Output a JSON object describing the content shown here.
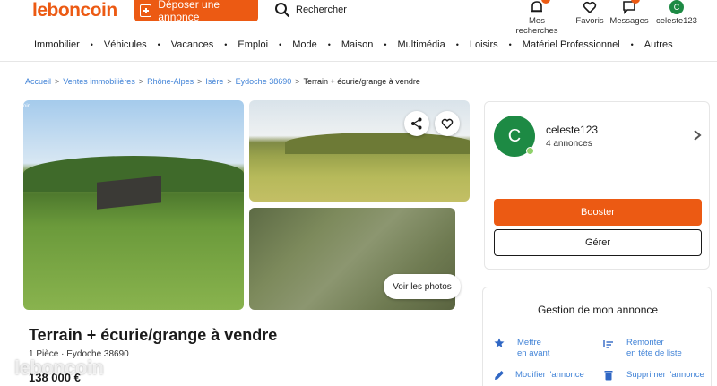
{
  "header": {
    "logo": "leboncoin",
    "deposer_label": "Déposer une annonce",
    "search_label": "Rechercher",
    "items": [
      {
        "label": "Mes recherches",
        "icon": "bell-icon"
      },
      {
        "label": "Favoris",
        "icon": "heart-icon"
      },
      {
        "label": "Messages",
        "icon": "chat-icon"
      },
      {
        "label": "celeste123",
        "icon": "avatar-icon",
        "avatar_letter": "C"
      }
    ]
  },
  "nav": [
    "Immobilier",
    "Véhicules",
    "Vacances",
    "Emploi",
    "Mode",
    "Maison",
    "Multimédia",
    "Loisirs",
    "Matériel Professionnel",
    "Autres"
  ],
  "breadcrumb": [
    "Accueil",
    "Ventes immobilières",
    "Rhône-Alpes",
    "Isère",
    "Eydoche 38690",
    "Terrain + écurie/grange à vendre"
  ],
  "gallery": {
    "voir_photos": "Voir les photos",
    "corner_text": "oin"
  },
  "listing": {
    "title": "Terrain + écurie/grange à vendre",
    "subtitle": "1 Pièce · Eydoche 38690",
    "price": "138 000 €",
    "watermark": "leboncoin"
  },
  "seller": {
    "avatar_letter": "C",
    "name": "celeste123",
    "count": "4 annonces",
    "booster_label": "Booster",
    "gerer_label": "Gérer"
  },
  "gestion": {
    "title": "Gestion de mon annonce",
    "actions": [
      {
        "line1": "Mettre",
        "line2": "en avant",
        "icon": "star-icon"
      },
      {
        "line1": "Remonter",
        "line2": "en tête de liste",
        "icon": "sort-icon"
      },
      {
        "line1": "Modifier l'annonce",
        "line2": "",
        "icon": "pencil-icon"
      },
      {
        "line1": "Supprimer l'annonce",
        "line2": "",
        "icon": "trash-icon"
      }
    ]
  },
  "colors": {
    "brand": "#ec5a13",
    "link": "#4183d7",
    "avatar": "#1d8a44"
  }
}
